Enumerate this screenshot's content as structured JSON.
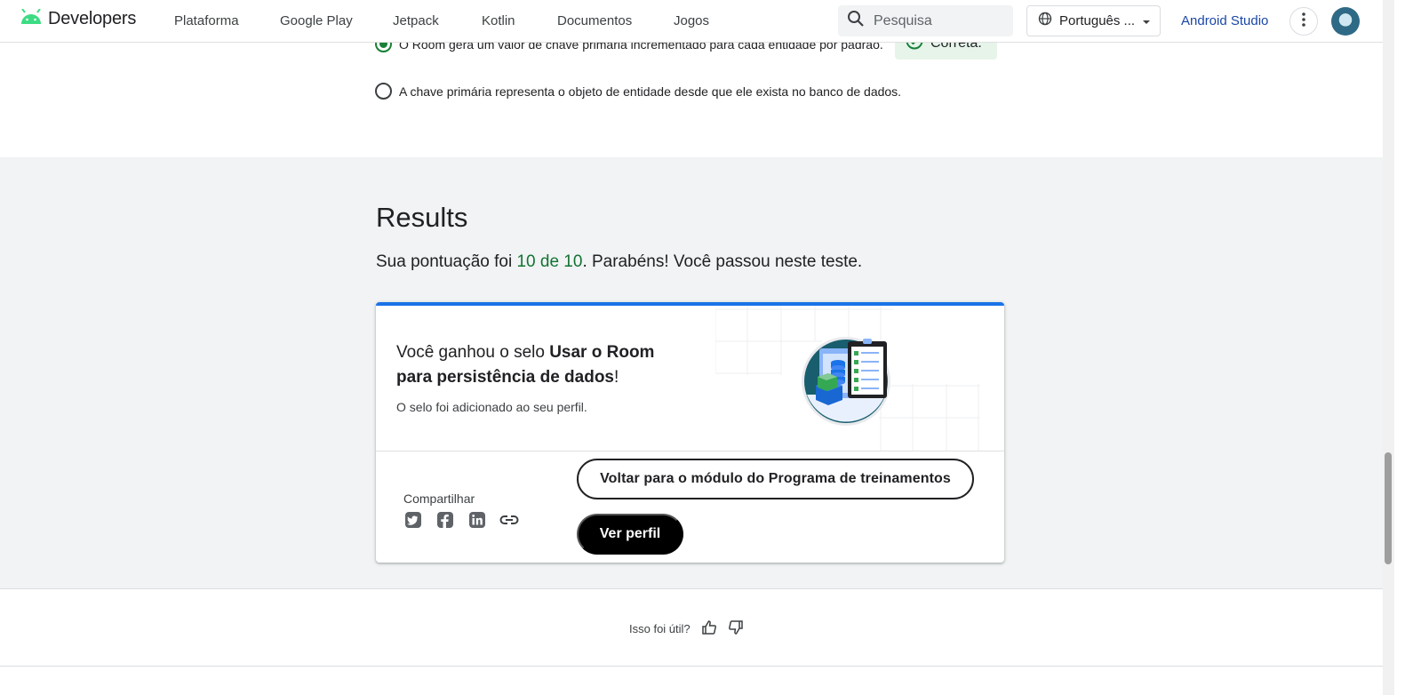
{
  "nav": {
    "logo_text": "Developers",
    "items": [
      "Plataforma",
      "Google Play",
      "Jetpack",
      "Kotlin",
      "Documentos",
      "Jogos"
    ],
    "search_placeholder": "Pesquisa",
    "language": "Português ...",
    "studio_link": "Android Studio"
  },
  "quiz": {
    "option_selected": "O Room gera um valor de chave primária incrementado para cada entidade por padrão.",
    "correct_label": "Correta.",
    "option_other": "A chave primária representa o objeto de entidade desde que ele exista no banco de dados."
  },
  "results": {
    "title": "Results",
    "score_prefix": "Sua pontuação foi ",
    "score_value": "10 de 10",
    "score_suffix": ". Parabéns! Você passou neste teste."
  },
  "badge_card": {
    "title_prefix": "Você ganhou o selo ",
    "badge_name": "Usar o Room para persistência de dados",
    "title_suffix": "!",
    "subtitle": "O selo foi adicionado ao seu perfil.",
    "share_label": "Compartilhar",
    "share_icons": [
      "twitter-icon",
      "facebook-icon",
      "linkedin-icon",
      "link-icon"
    ],
    "back_button": "Voltar para o módulo do Programa de treinamentos",
    "profile_button": "Ver perfil"
  },
  "feedback": {
    "question": "Isso foi útil?"
  },
  "colors": {
    "accent_blue": "#1a73e8",
    "success_green": "#188038",
    "android_green": "#3ddc84",
    "link_blue": "#1a47a6"
  }
}
